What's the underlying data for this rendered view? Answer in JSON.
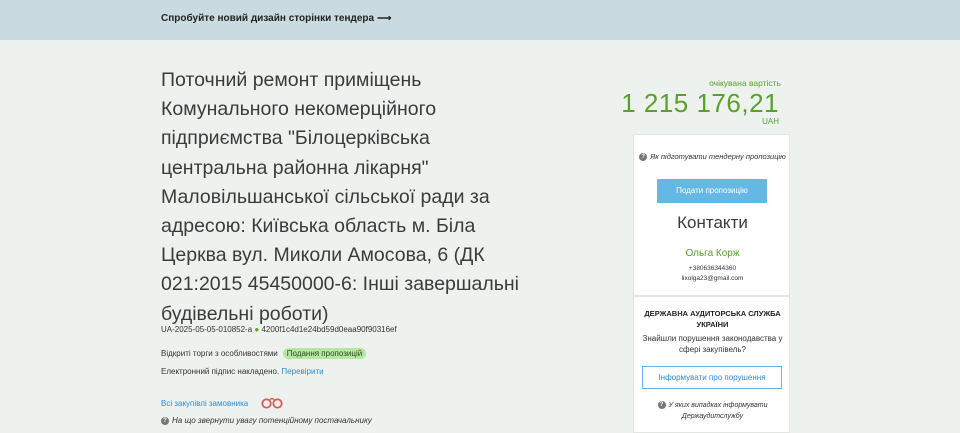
{
  "banner": {
    "text": "Спробуйте новий дизайн сторінки тендера",
    "arrow": "⟶"
  },
  "tender": {
    "title": "Поточний ремонт приміщень Комунального некомерційного підприємства \"Білоцерківська центральна районна лікарня\" Маловільшанської сільської ради за адресою: Київська область м. Біла Церква вул. Миколи Амосова, 6 (ДК 021:2015 45450000-6: Інші завершальні будівельні роботи)",
    "id": "UA-2025-05-05-010852-a",
    "hash_dot": "●",
    "hash": "4200f1c4d1e24bd59d0eaa90f90316ef",
    "procedure": "Відкриті торги з особливостями",
    "status": "Подання пропозицій",
    "signature_text": "Електронний підпис накладено.",
    "signature_link": "Перевірити",
    "all_purchases": "Всі закупівлі замовника",
    "attention_text": "На що звернути увагу потенційному постачальнику"
  },
  "price": {
    "label": "очікувана вартість",
    "value": "1 215 176,21",
    "currency": "UAH"
  },
  "sidebar": {
    "how_to": "Як підготувати тендерну пропозицію",
    "submit": "Подати пропозицію",
    "contacts_title": "Контакти",
    "contact_name": "Ольга Корж",
    "contact_phone": "+380636344360",
    "contact_email": "lixolga23@gmail.com"
  },
  "audit": {
    "title": "ДЕРЖАВНА АУДИТОРСЬКА СЛУЖБА УКРАЇНИ",
    "question": "Знайшли порушення законодавства у сфері закупівель?",
    "report": "Інформувати про порушення",
    "note": "У яких випадках інформувати Держаудитслужбу"
  },
  "colors": {
    "accent_green": "#5aa02c",
    "link_blue": "#2a8ed6",
    "button_blue": "#63b8e6",
    "banner_bg": "#c9dbe0",
    "badge_bg": "#b7e6a3"
  },
  "icons": {
    "arrow": "arrow-right-icon",
    "help": "question-circle-icon",
    "handcuffs": "handcuffs-icon"
  }
}
